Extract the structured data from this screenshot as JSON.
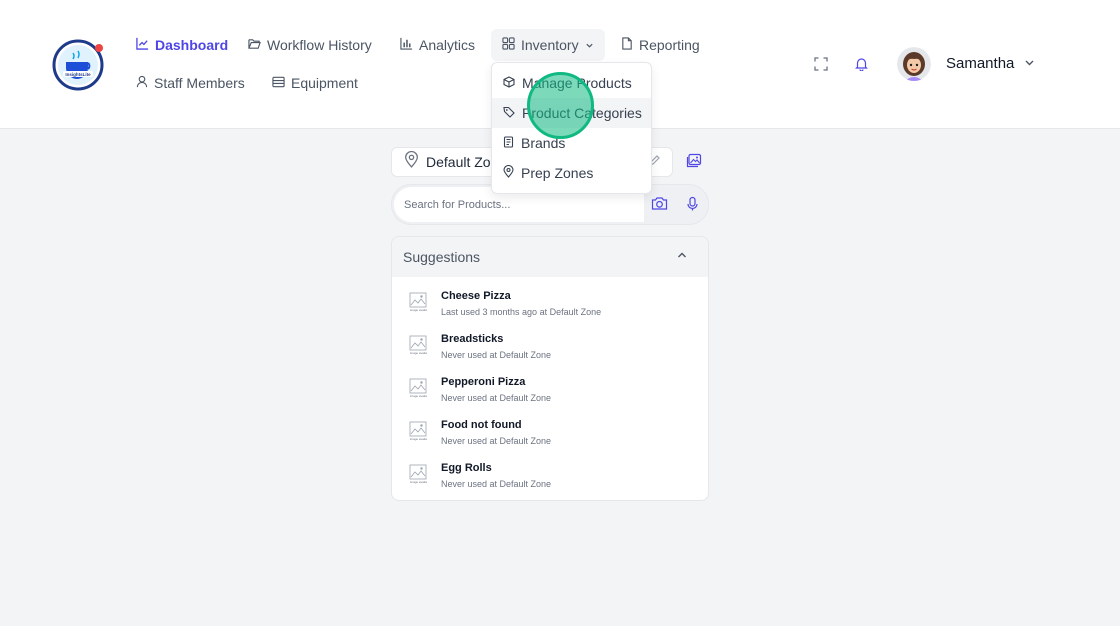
{
  "header": {
    "logo_alt": "InsightsLite",
    "nav": [
      {
        "label": "Dashboard",
        "icon": "chart-line-icon"
      },
      {
        "label": "Workflow History",
        "icon": "folder-open-icon"
      },
      {
        "label": "Analytics",
        "icon": "bar-chart-icon"
      },
      {
        "label": "Inventory",
        "icon": "grid-icon"
      },
      {
        "label": "Reporting",
        "icon": "file-icon"
      },
      {
        "label": "Staff Members",
        "icon": "user-icon"
      },
      {
        "label": "Equipment",
        "icon": "list-icon"
      }
    ],
    "user": {
      "name": "Samantha"
    }
  },
  "inventory_menu": {
    "items": [
      {
        "label": "Manage Products",
        "icon": "box-icon"
      },
      {
        "label": "Product Categories",
        "icon": "tag-icon"
      },
      {
        "label": "Brands",
        "icon": "book-icon"
      },
      {
        "label": "Prep Zones",
        "icon": "map-pin-icon"
      }
    ]
  },
  "location": {
    "value": "Default Zone"
  },
  "search": {
    "placeholder": "Search for Products..."
  },
  "suggestions": {
    "title": "Suggestions",
    "thumb_text": "No image available",
    "items": [
      {
        "name": "Cheese Pizza",
        "detail": "Last used 3 months ago at Default Zone"
      },
      {
        "name": "Breadsticks",
        "detail": "Never used at Default Zone"
      },
      {
        "name": "Pepperoni Pizza",
        "detail": "Never used at Default Zone"
      },
      {
        "name": "Food not found",
        "detail": "Never used at Default Zone"
      },
      {
        "name": "Egg Rolls",
        "detail": "Never used at Default Zone"
      }
    ]
  },
  "colors": {
    "accent": "#4f46e5",
    "click_marker": "#10b981"
  }
}
